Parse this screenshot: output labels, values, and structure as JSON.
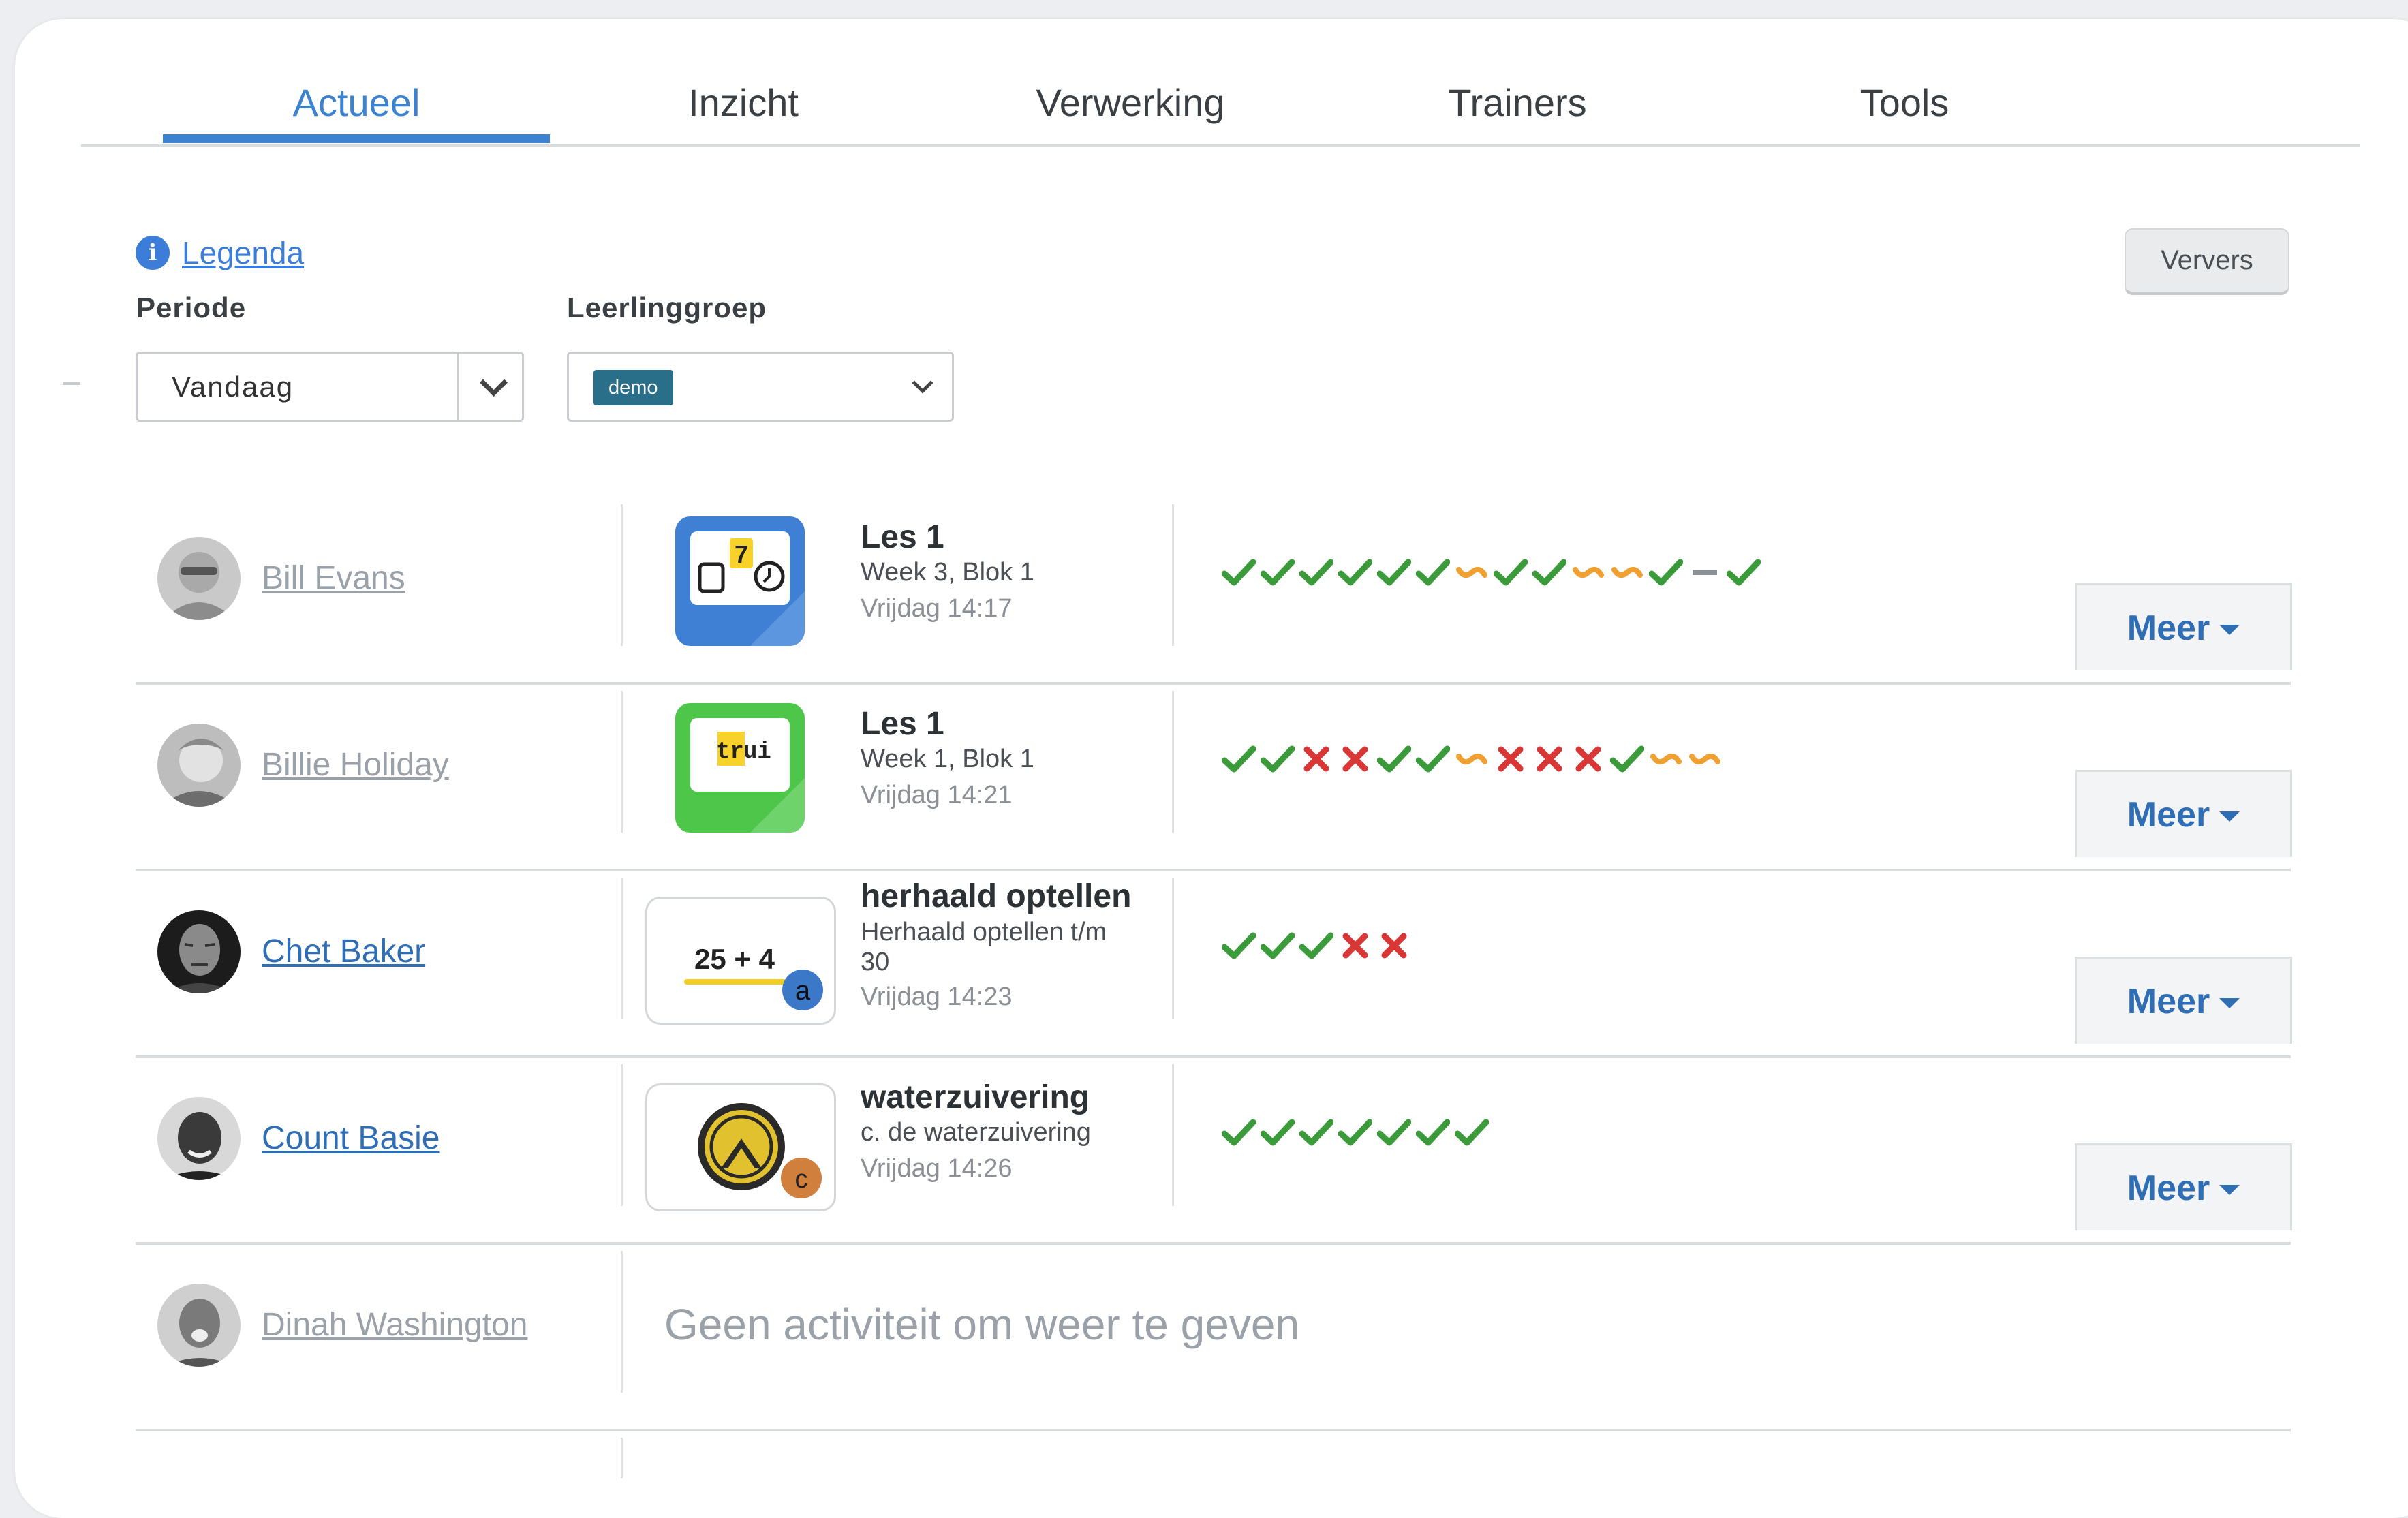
{
  "tabs": [
    {
      "label": "Actueel",
      "active": true
    },
    {
      "label": "Inzicht",
      "active": false
    },
    {
      "label": "Verwerking",
      "active": false
    },
    {
      "label": "Trainers",
      "active": false
    },
    {
      "label": "Tools",
      "active": false
    }
  ],
  "legend_link": "Legenda",
  "refresh_button": "Ververs",
  "filters": {
    "periode": {
      "label": "Periode",
      "value": "Vandaag"
    },
    "leerlinggroep": {
      "label": "Leerlinggroep",
      "tag": "demo"
    }
  },
  "meer_label": "Meer",
  "colors": {
    "accent": "#3b82d0",
    "check": "#3b9b3b",
    "cross": "#d93636",
    "partial": "#f0a030",
    "skipped": "#8a8f94"
  },
  "students": [
    {
      "name": "Bill Evans",
      "activity": {
        "title": "Les 1",
        "subtitle": "Week 3, Blok 1",
        "time": "Vrijdag 14:17",
        "icon": "bus-clock-app-icon",
        "icon_text": "7"
      },
      "results": [
        "check",
        "check",
        "check",
        "check",
        "check",
        "check",
        "partial",
        "check",
        "check",
        "partial",
        "partial",
        "check",
        "skipped",
        "check"
      ]
    },
    {
      "name": "Billie Holiday",
      "activity": {
        "title": "Les 1",
        "subtitle": "Week 1, Blok 1",
        "time": "Vrijdag 14:21",
        "icon": "word-app-icon",
        "icon_text_a": "tr",
        "icon_text_b": "ui"
      },
      "results": [
        "check",
        "check",
        "cross",
        "cross",
        "check",
        "check",
        "partial",
        "cross",
        "cross",
        "cross",
        "check",
        "partial",
        "partial"
      ]
    },
    {
      "name": "Chet Baker",
      "activity": {
        "title": "herhaald optellen",
        "subtitle_line1": "Herhaald optellen t/m",
        "subtitle_line2": "30",
        "time": "Vrijdag 14:23",
        "icon": "sum-card-icon",
        "icon_text": "25 + 4",
        "badge": "a"
      },
      "results": [
        "check",
        "check",
        "check",
        "cross",
        "cross"
      ]
    },
    {
      "name": "Count Basie",
      "activity": {
        "title": "waterzuivering",
        "subtitle": "c. de waterzuivering",
        "time": "Vrijdag 14:26",
        "icon": "tunnel-card-icon",
        "badge": "c"
      },
      "results": [
        "check",
        "check",
        "check",
        "check",
        "check",
        "check",
        "check"
      ]
    },
    {
      "name": "Dinah Washington",
      "empty_message": "Geen activiteit om weer te geven"
    }
  ]
}
